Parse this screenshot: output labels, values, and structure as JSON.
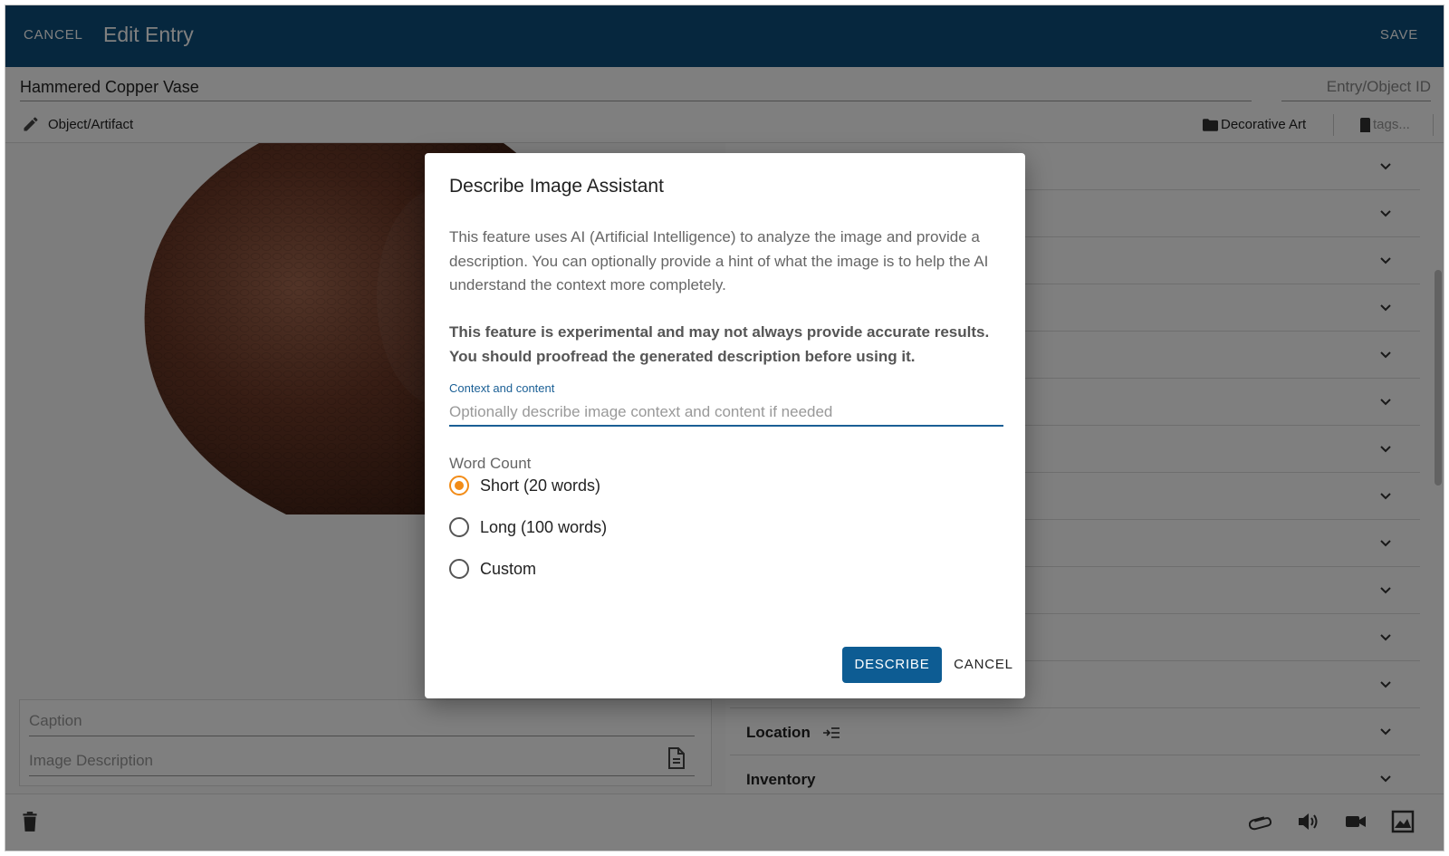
{
  "topbar": {
    "cancel_label": "CANCEL",
    "title": "Edit Entry",
    "save_label": "SAVE",
    "color": "#0d4f7c"
  },
  "entry": {
    "title": "Hammered Copper Vase",
    "id_placeholder": "Entry/Object ID",
    "type": "Object/Artifact",
    "category": "Decorative Art",
    "tags_placeholder": "tags..."
  },
  "image_panel": {
    "caption_placeholder": "Caption",
    "description_placeholder": "Image Description"
  },
  "accordion": {
    "items": [
      {
        "label": ""
      },
      {
        "label": ""
      },
      {
        "label": ""
      },
      {
        "label": ""
      },
      {
        "label": ""
      },
      {
        "label": ""
      },
      {
        "label": ""
      },
      {
        "label": ""
      },
      {
        "label": ""
      },
      {
        "label": ""
      },
      {
        "label": ""
      },
      {
        "label": ""
      },
      {
        "label": "Location"
      },
      {
        "label": "Inventory"
      }
    ]
  },
  "dialog": {
    "title": "Describe Image Assistant",
    "description": "This feature uses AI (Artificial Intelligence) to analyze the image and provide a description. You can optionally provide a hint of what the image is to help the AI understand the context more completely.",
    "warning": "This feature is experimental and may not always provide accurate results. You should proofread the generated description before using it.",
    "context_label": "Context and content",
    "context_placeholder": "Optionally describe image context and content if needed",
    "word_count_label": "Word Count",
    "options": [
      {
        "label": "Short (20 words)",
        "selected": true
      },
      {
        "label": "Long (100 words)",
        "selected": false
      },
      {
        "label": "Custom",
        "selected": false
      }
    ],
    "describe_label": "DESCRIBE",
    "cancel_label": "CANCEL",
    "accent_color": "#f28c18",
    "primary_color": "#0d5c93"
  },
  "bottombar": {
    "icons": [
      "trash-icon",
      "attachment-icon",
      "audio-icon",
      "video-icon",
      "image-icon"
    ]
  }
}
